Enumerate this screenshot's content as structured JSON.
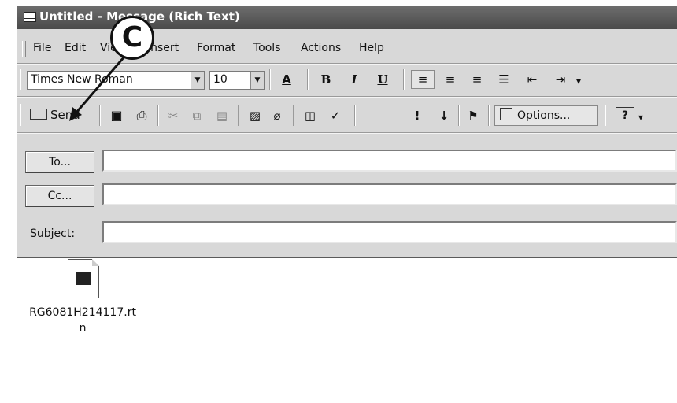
{
  "window": {
    "title": "Untitled - Message (Rich Text)"
  },
  "menu": [
    "File",
    "Edit",
    "View",
    "Insert",
    "Format",
    "Tools",
    "Actions",
    "Help"
  ],
  "format_toolbar": {
    "font": "Times New Roman",
    "size": "10",
    "color_label": "A",
    "bold": "B",
    "italic": "I",
    "underline": "U"
  },
  "standard_toolbar": {
    "send": "Send",
    "options": "Options...",
    "importance_high": "!",
    "importance_low": "↓"
  },
  "header": {
    "to_label": "To...",
    "cc_label": "Cc...",
    "subject_label": "Subject:",
    "to_value": "",
    "cc_value": "",
    "subject_value": ""
  },
  "attachment": {
    "line1": "RG6081H214117.rt",
    "line2": "n"
  },
  "callout": {
    "letter": "C"
  }
}
